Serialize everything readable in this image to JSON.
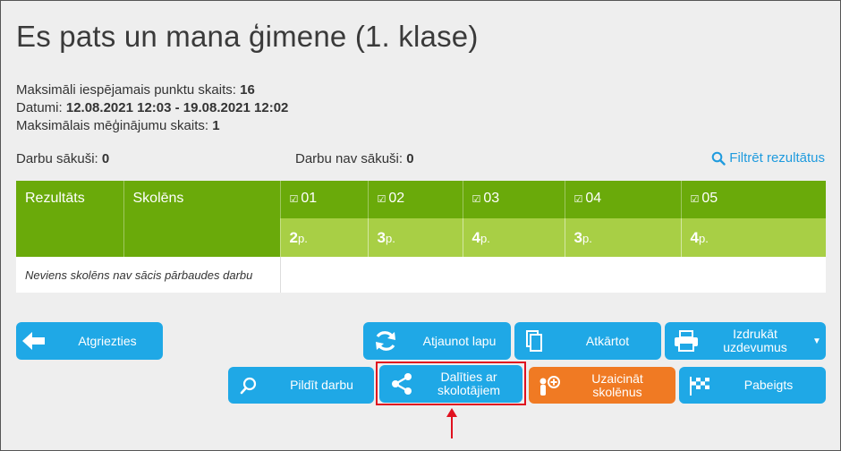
{
  "title": "Es pats un mana ģimene (1. klase)",
  "info": {
    "max_points_label": "Maksimāli iespējamais punktu skaits:",
    "max_points_value": "16",
    "dates_label": "Datumi:",
    "dates_value": "12.08.2021 12:03 - 19.08.2021 12:02",
    "max_attempts_label": "Maksimālais mēģinājumu skaits:",
    "max_attempts_value": "1",
    "started_label": "Darbu sākuši:",
    "started_value": "0",
    "not_started_label": "Darbu nav sākuši:",
    "not_started_value": "0",
    "filter_label": "Filtrēt rezultātus"
  },
  "table": {
    "col_result": "Rezultāts",
    "col_student": "Skolēns",
    "questions": [
      {
        "label": "01",
        "points": "2",
        "unit": "p."
      },
      {
        "label": "02",
        "points": "3",
        "unit": "p."
      },
      {
        "label": "03",
        "points": "4",
        "unit": "p."
      },
      {
        "label": "04",
        "points": "3",
        "unit": "p."
      },
      {
        "label": "05",
        "points": "4",
        "unit": "p."
      }
    ],
    "empty_message": "Neviens skolēns nav sācis pārbaudes darbu"
  },
  "buttons": {
    "back": "Atgriezties",
    "refresh": "Atjaunot lapu",
    "repeat": "Atkārtot",
    "print": "Izdrukāt uzdevumus",
    "fill": "Pildīt darbu",
    "share": "Dalīties ar skolotājiem",
    "invite": "Uzaicināt skolēnus",
    "finish": "Pabeigts"
  },
  "colors": {
    "header_green": "#6aaa0a",
    "points_green": "#a8cf45",
    "button_blue": "#1fa8e6",
    "button_orange": "#f07a23",
    "highlight_red": "#e0111f",
    "link_blue": "#1f9bde"
  }
}
